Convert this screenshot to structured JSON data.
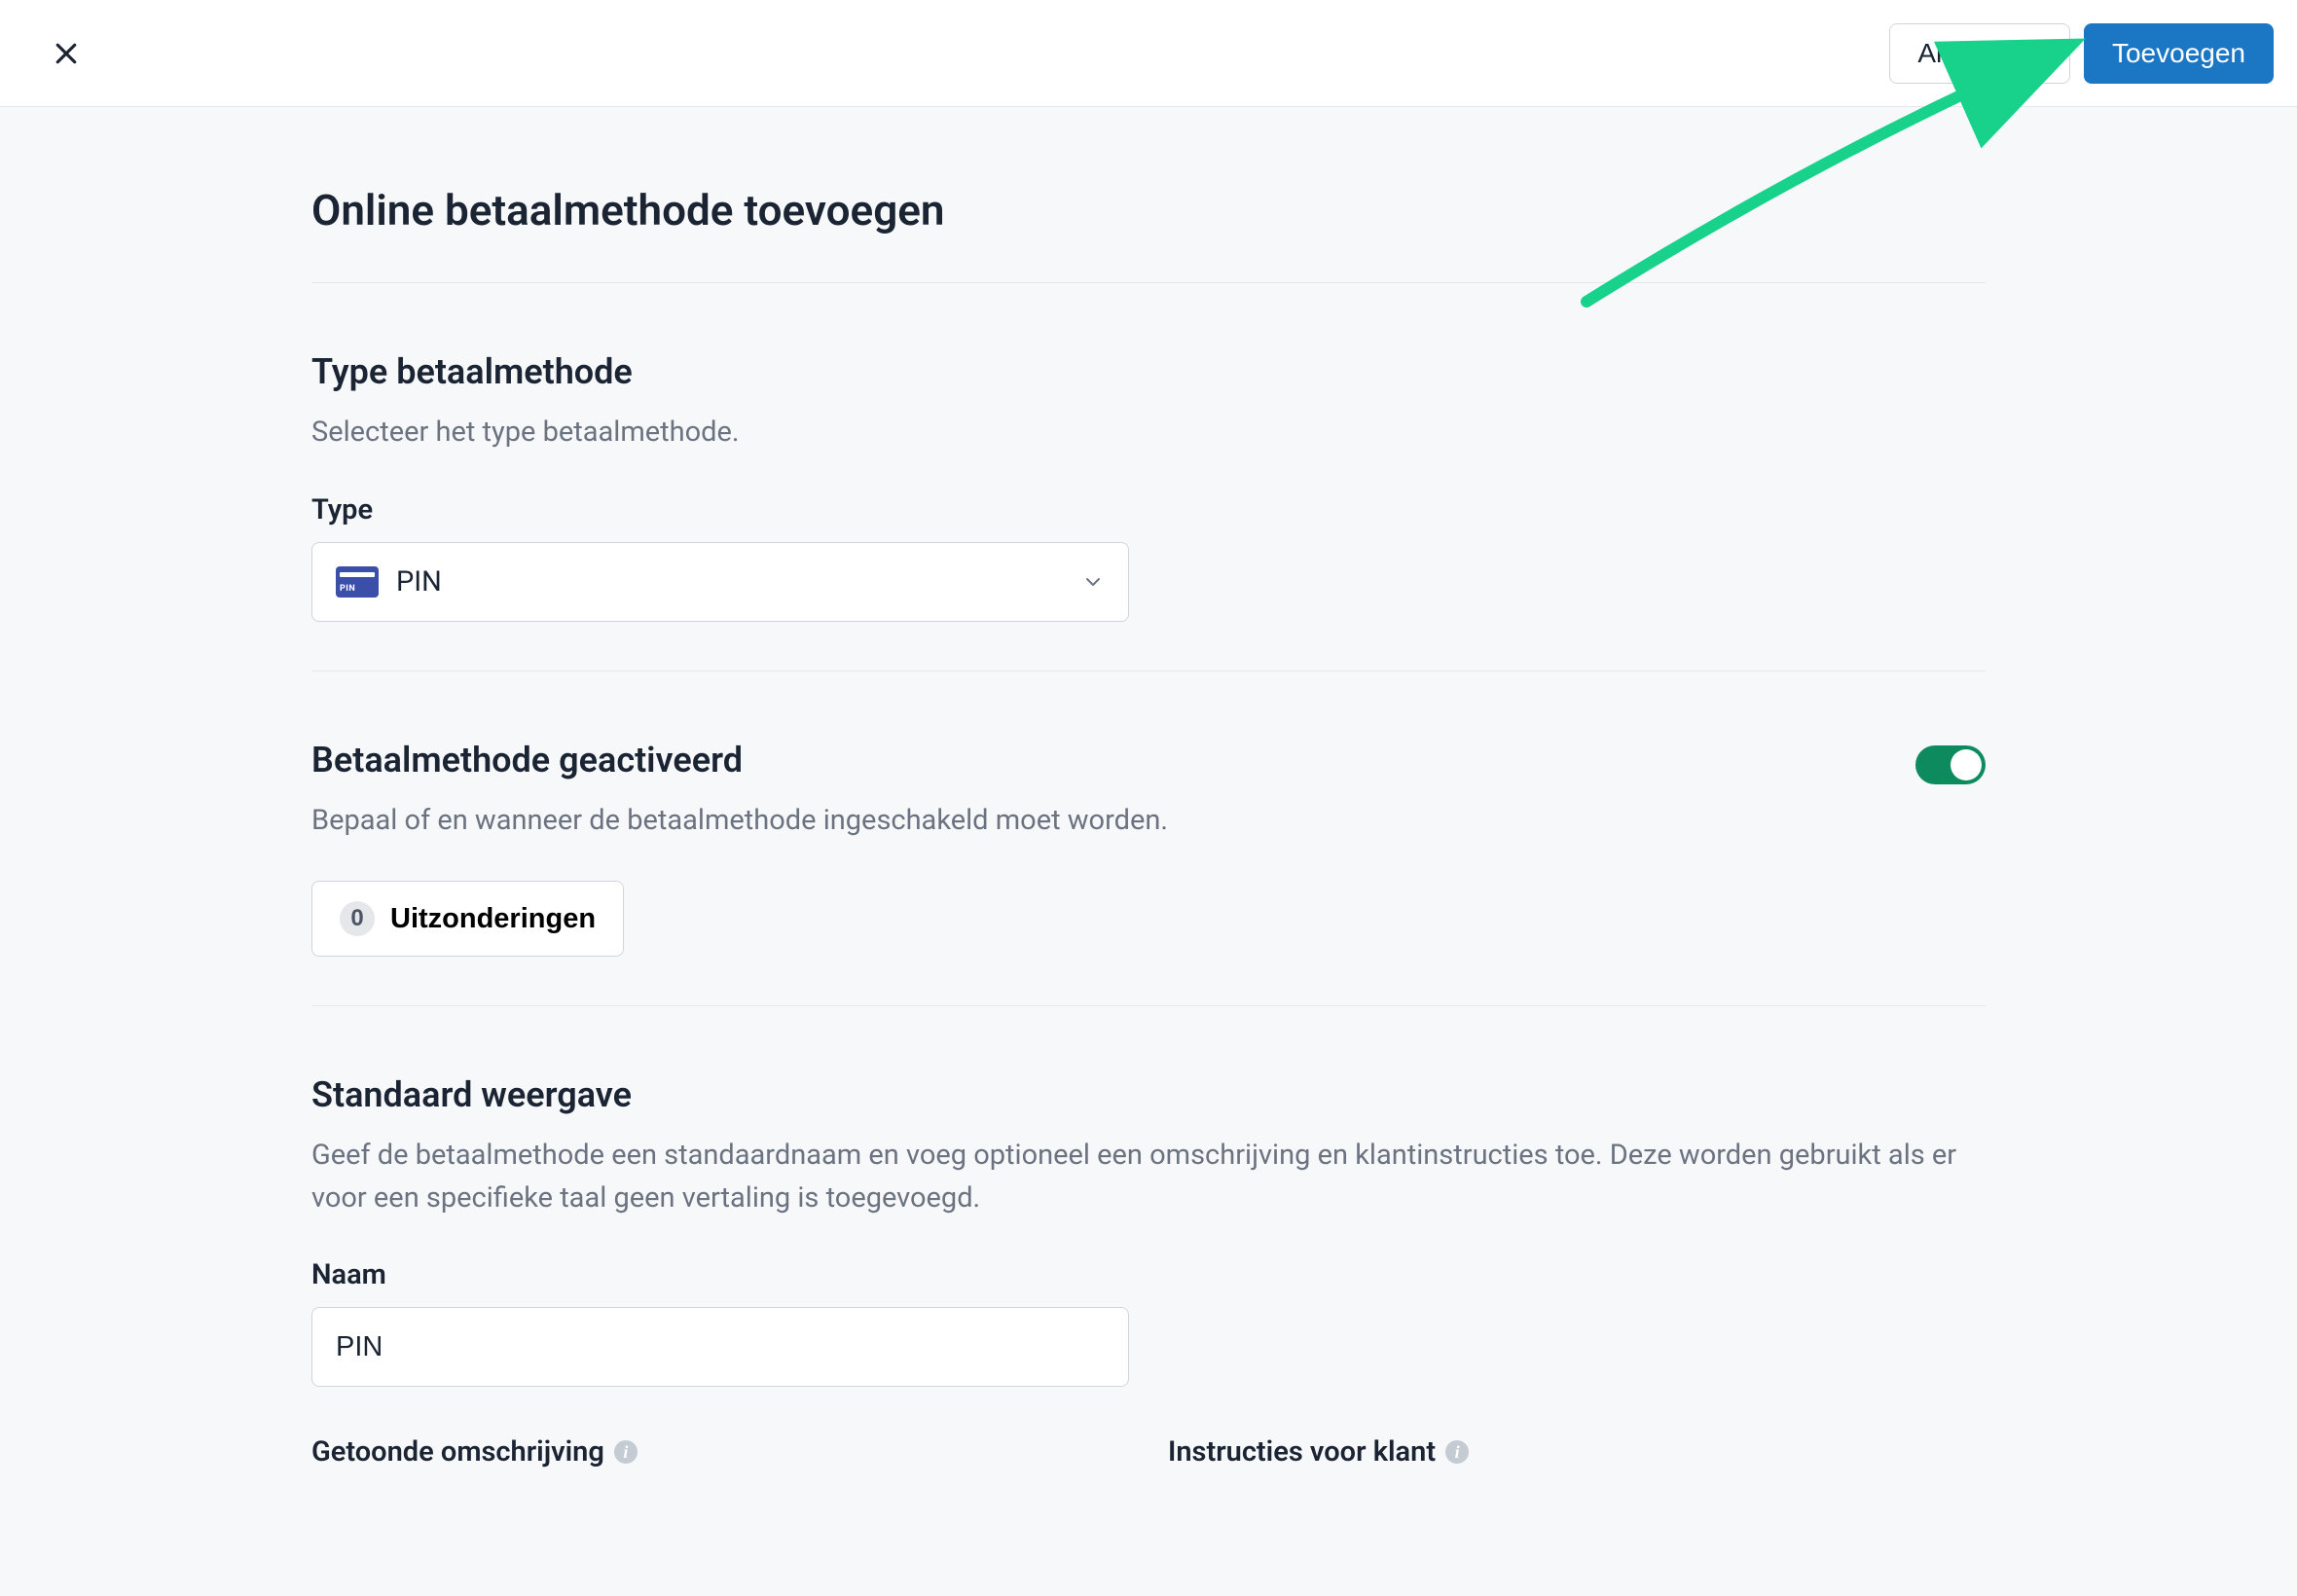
{
  "header": {
    "cancel_label": "Annuleren",
    "submit_label": "Toevoegen"
  },
  "page": {
    "title": "Online betaalmethode toevoegen"
  },
  "sections": {
    "type": {
      "title": "Type betaalmethode",
      "description": "Selecteer het type betaalmethode.",
      "field_label": "Type",
      "selected_value": "PIN"
    },
    "activated": {
      "title": "Betaalmethode geactiveerd",
      "description": "Bepaal of en wanneer de betaalmethode ingeschakeld moet worden.",
      "exceptions_label": "Uitzonderingen",
      "exceptions_count": "0",
      "toggle_on": true
    },
    "display": {
      "title": "Standaard weergave",
      "description": "Geef de betaalmethode een standaardnaam en voeg optioneel een omschrijving en klantinstructies toe. Deze worden gebruikt als er voor een specifieke taal geen vertaling is toegevoegd.",
      "name_label": "Naam",
      "name_value": "PIN",
      "shown_desc_label": "Getoonde omschrijving",
      "instructions_label": "Instructies voor klant"
    }
  },
  "colors": {
    "primary": "#1b76c4",
    "toggle_on": "#0d8a5e",
    "annotation": "#18d28b"
  }
}
